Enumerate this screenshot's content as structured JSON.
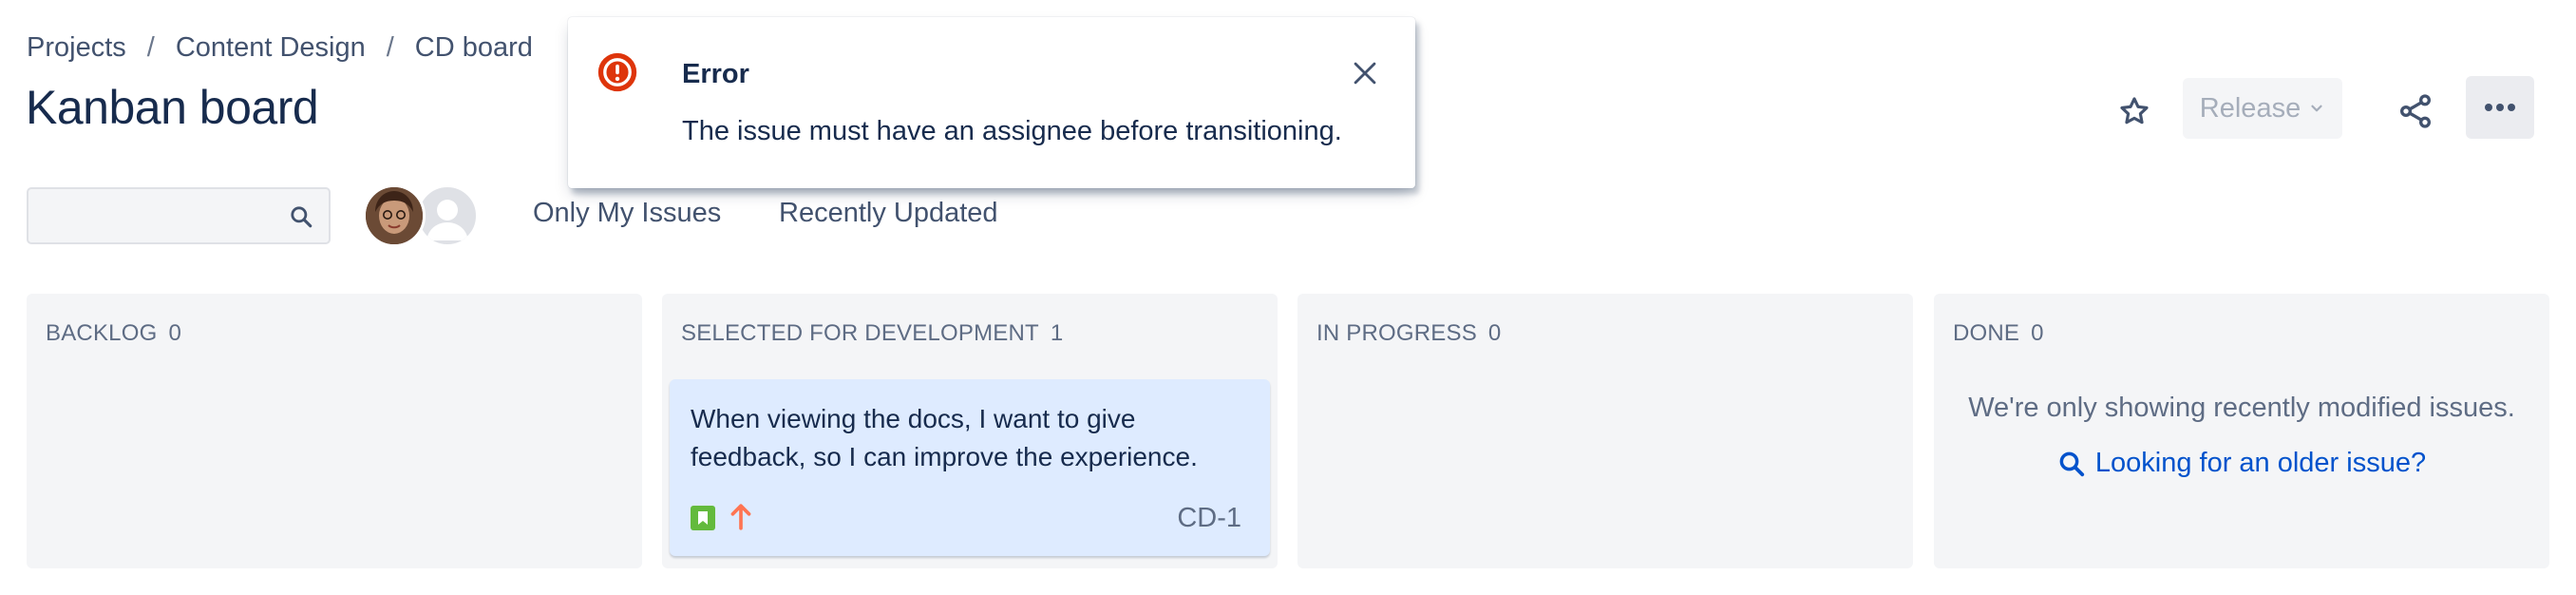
{
  "breadcrumb": {
    "items": [
      "Projects",
      "Content Design",
      "CD board"
    ],
    "separator": "/"
  },
  "page": {
    "title": "Kanban board"
  },
  "header": {
    "release_label": "Release",
    "icons": [
      "star-icon",
      "chevron-down-icon",
      "share-icon",
      "more-icon"
    ]
  },
  "filters": {
    "search_value": "",
    "quick_filters": [
      "Only My Issues",
      "Recently Updated"
    ]
  },
  "columns": [
    {
      "name": "BACKLOG",
      "count": "0"
    },
    {
      "name": "SELECTED FOR DEVELOPMENT",
      "count": "1"
    },
    {
      "name": "IN PROGRESS",
      "count": "0"
    },
    {
      "name": "DONE",
      "count": "0"
    }
  ],
  "card": {
    "summary": "When viewing the docs, I want to give feedback, so I can improve the experience.",
    "key": "CD-1",
    "type_icon": "story-icon",
    "priority_icon": "priority-high-icon"
  },
  "done_column": {
    "message": "We're only showing recently modified issues.",
    "link": "Looking for an older issue?"
  },
  "flag": {
    "title": "Error",
    "body": "The issue must have an assignee before transitioning.",
    "icon": "error-icon"
  },
  "colors": {
    "error": "#de350b",
    "story": "#63ba3c",
    "priority_high": "#ff7452",
    "card_bg": "#deebff",
    "link": "#0052cc"
  }
}
